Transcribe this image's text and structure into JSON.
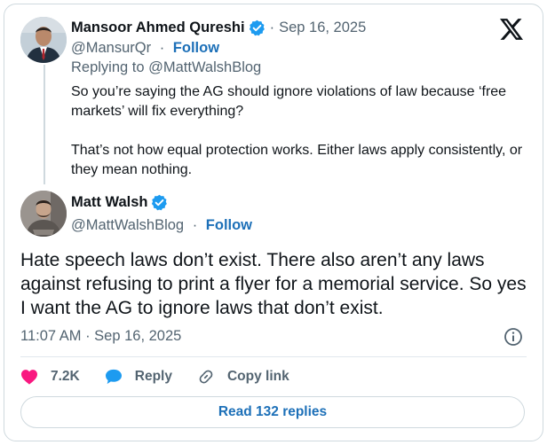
{
  "parent_tweet": {
    "author_name": "Mansoor Ahmed Qureshi",
    "date": "Sep 16, 2025",
    "handle": "@MansurQr",
    "follow_label": "Follow",
    "replying_to": "Replying to @MattWalshBlog",
    "paragraphs": [
      "So you’re saying the AG should ignore violations of law because ‘free markets’ will fix everything?",
      "That’s not how equal protection works. Either laws apply consistently, or they mean nothing."
    ]
  },
  "main_tweet": {
    "author_name": "Matt Walsh",
    "handle": "@MattWalshBlog",
    "follow_label": "Follow",
    "text": "Hate speech laws don’t exist. There also aren’t any laws against refusing to print a flyer for a memorial service. So yes I want the AG to ignore laws that don’t exist.",
    "timestamp": "11:07 AM · Sep 16, 2025"
  },
  "actions": {
    "like_count": "7.2K",
    "reply_label": "Reply",
    "copy_label": "Copy link"
  },
  "read_replies_label": "Read 132 replies",
  "separator": "·",
  "colors": {
    "verified": "#1d9bf0",
    "like": "#f91880",
    "link": "#1d70b8",
    "muted": "#536471",
    "border": "#cfd9de"
  },
  "icons": {
    "platform": "x-logo-icon",
    "verified": "verified-badge-icon",
    "like": "heart-icon",
    "reply": "speech-bubble-icon",
    "copy": "link-icon",
    "info": "info-icon"
  }
}
